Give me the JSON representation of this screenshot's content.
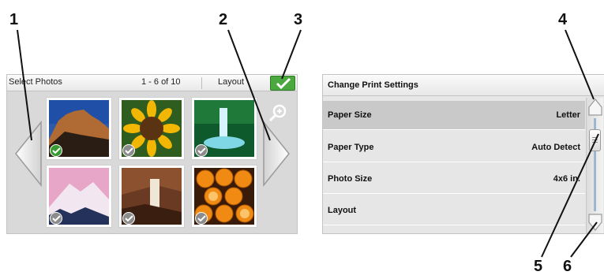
{
  "callouts": [
    "1",
    "2",
    "3",
    "4",
    "5",
    "6"
  ],
  "photo_panel": {
    "title": "Select Photos",
    "count": "1 - 6 of 10",
    "layout_label": "Layout",
    "photos": [
      {
        "subject": "mountain",
        "selected": true
      },
      {
        "subject": "sunflower",
        "selected": false
      },
      {
        "subject": "waterfall",
        "selected": false
      },
      {
        "subject": "snowy-peak",
        "selected": false
      },
      {
        "subject": "canyon-falls",
        "selected": false
      },
      {
        "subject": "oranges",
        "selected": false
      }
    ]
  },
  "settings_panel": {
    "title": "Change Print Settings",
    "rows": [
      {
        "label": "Paper Size",
        "value": "Letter",
        "selected": true
      },
      {
        "label": "Paper Type",
        "value": "Auto Detect",
        "selected": false
      },
      {
        "label": "Photo Size",
        "value": "4x6 in.",
        "selected": false
      },
      {
        "label": "Layout",
        "value": "",
        "selected": false
      }
    ]
  },
  "icons": {
    "prev": "left-arrow-icon",
    "next": "right-arrow-icon",
    "done": "checkmark-icon",
    "zoom": "zoom-in-icon",
    "scroll_up": "up-arrow-icon",
    "scroll_down": "down-arrow-icon"
  },
  "colors": {
    "done_green": "#4aa83e",
    "selected_check": "#3a9a32",
    "unselected_check": "#8c8c8c",
    "selected_row": "#c9c9c9"
  }
}
